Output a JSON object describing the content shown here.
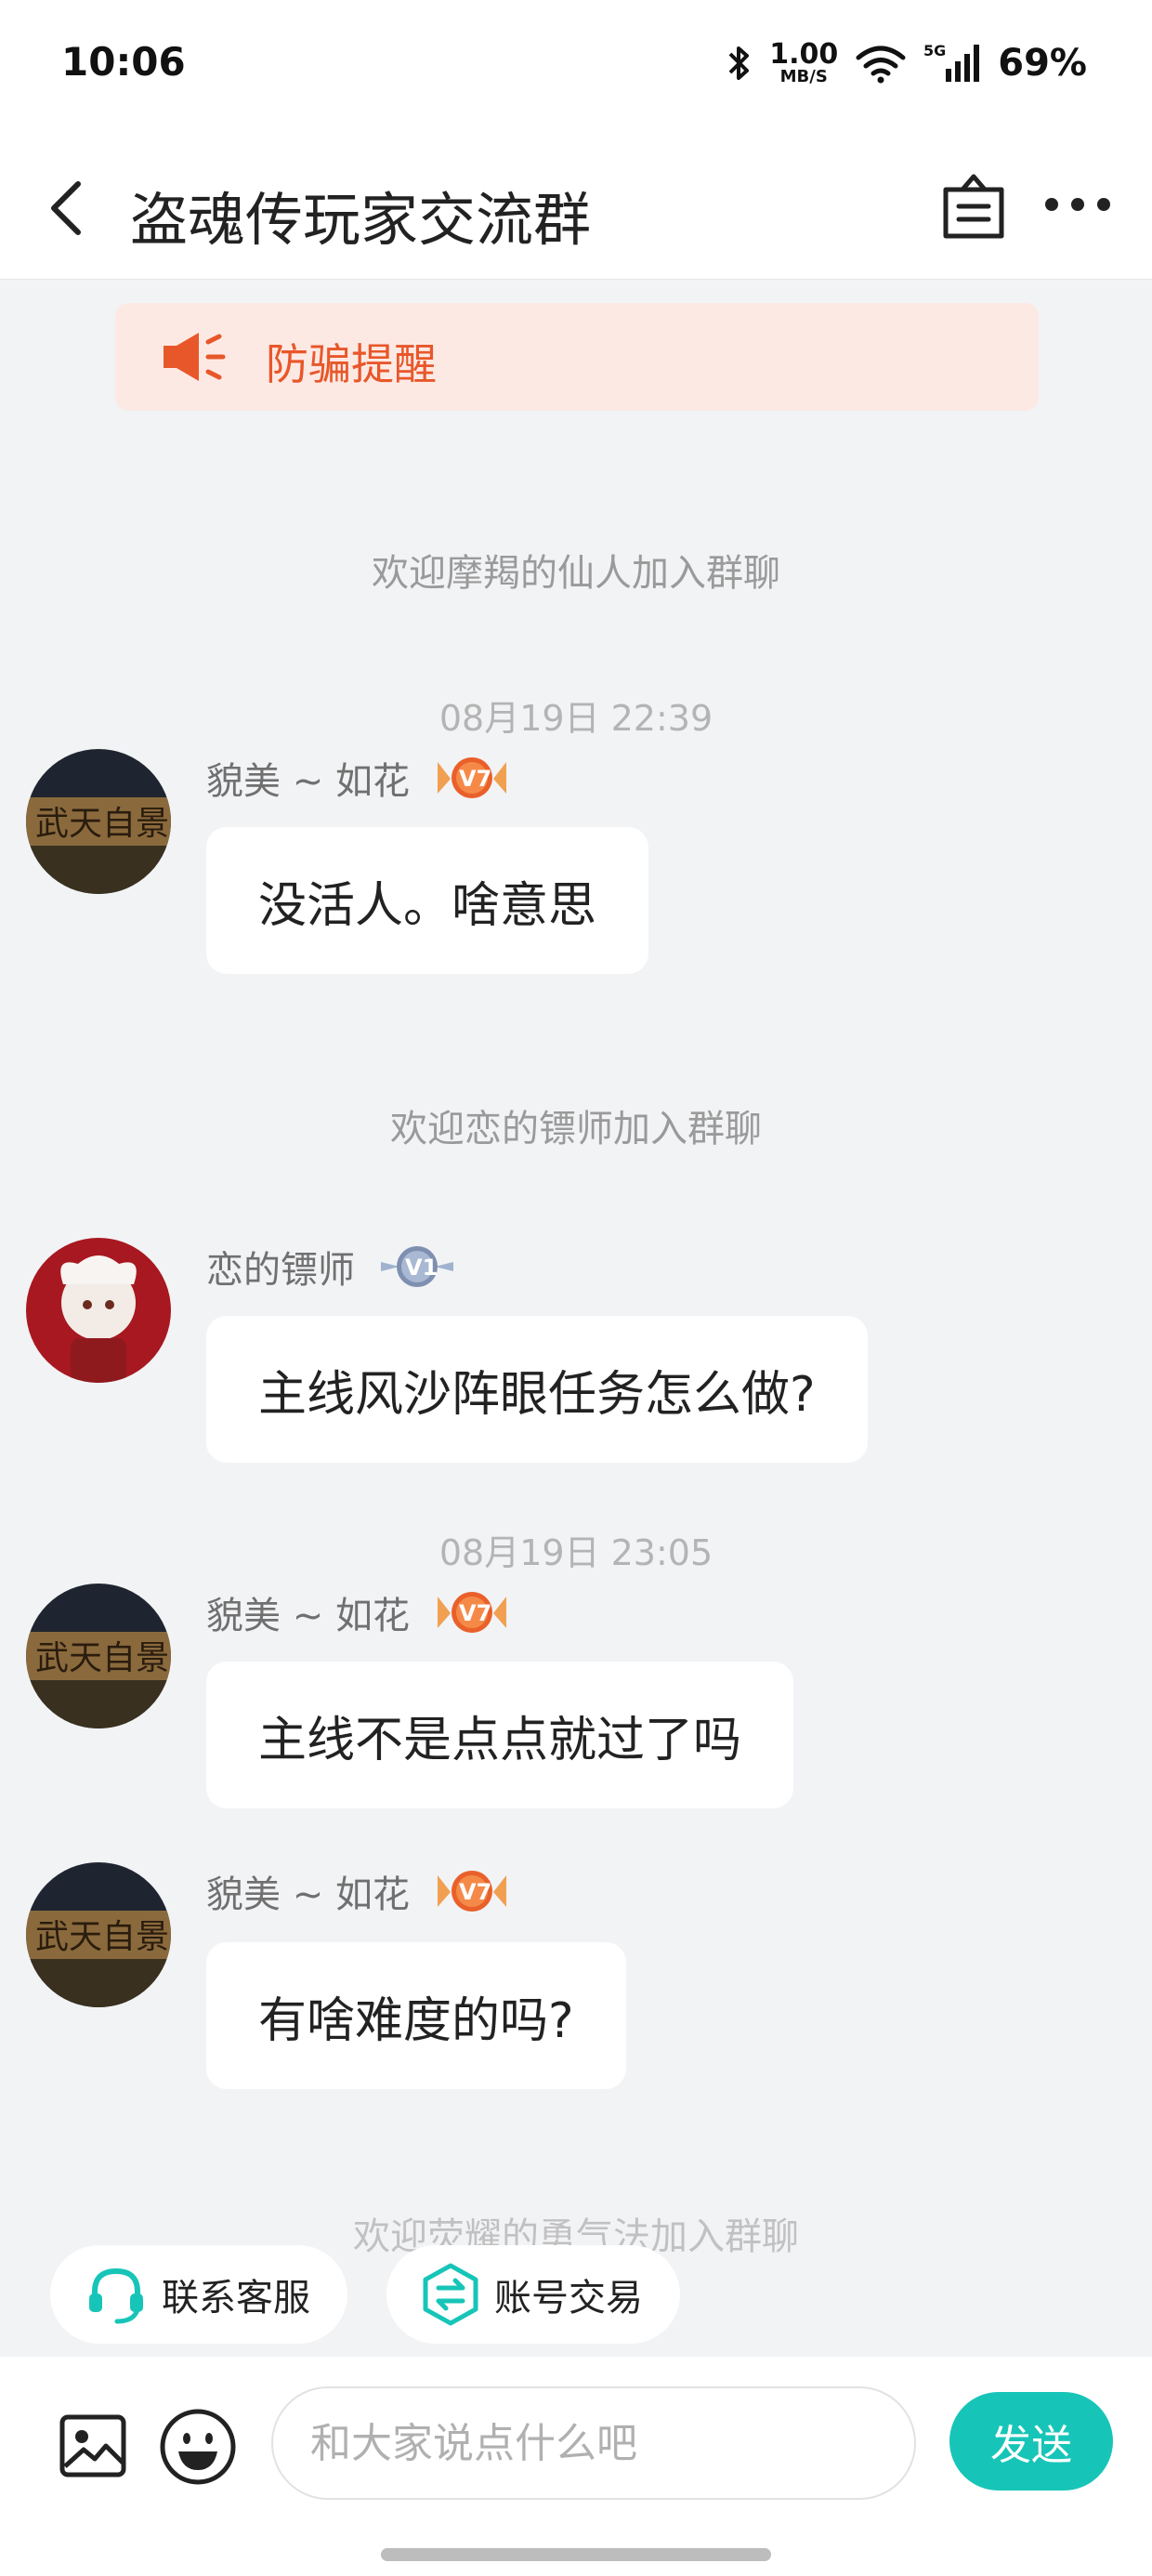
{
  "status_bar": {
    "time": "10:06",
    "net_speed_value": "1.00",
    "net_speed_unit": "MB/S",
    "network": "5G",
    "battery": "69%",
    "icons": [
      "bluetooth-icon",
      "wifi-icon",
      "signal-icon"
    ]
  },
  "header": {
    "title": "盗魂传玩家交流群",
    "icons": [
      "back-icon",
      "shop-bag-icon",
      "more-icon"
    ]
  },
  "notice": {
    "text": "防骗提醒",
    "icon": "megaphone-icon",
    "color": "#e8572a"
  },
  "messages": [
    {
      "type": "system",
      "text": "欢迎摩羯的仙人加入群聊"
    },
    {
      "type": "time",
      "text": "08月19日 22:39"
    },
    {
      "type": "chat",
      "sender": "貌美 ~ 如花",
      "badge": "V7",
      "text": "没活人。啥意思"
    },
    {
      "type": "system",
      "text": "欢迎恋的镖师加入群聊"
    },
    {
      "type": "chat",
      "sender": "恋的镖师",
      "badge": "V1",
      "text": "主线风沙阵眼任务怎么做?"
    },
    {
      "type": "time",
      "text": "08月19日 23:05"
    },
    {
      "type": "chat",
      "sender": "貌美 ~ 如花",
      "badge": "V7",
      "text": "主线不是点点就过了吗"
    },
    {
      "type": "chat",
      "sender": "貌美 ~ 如花",
      "badge": "V7",
      "text": "有啥难度的吗?"
    },
    {
      "type": "system",
      "text": "欢迎荧耀的勇气法加入群聊"
    }
  ],
  "quick_actions": [
    {
      "label": "联系客服",
      "icon": "headset-icon"
    },
    {
      "label": "账号交易",
      "icon": "exchange-icon"
    }
  ],
  "composer": {
    "placeholder": "和大家说点什么吧",
    "value": "",
    "send_label": "发送",
    "icons": [
      "image-icon",
      "emoji-icon"
    ]
  },
  "colors": {
    "accent": "#17c5b8",
    "warning": "#e8572a",
    "background": "#f2f3f5"
  }
}
